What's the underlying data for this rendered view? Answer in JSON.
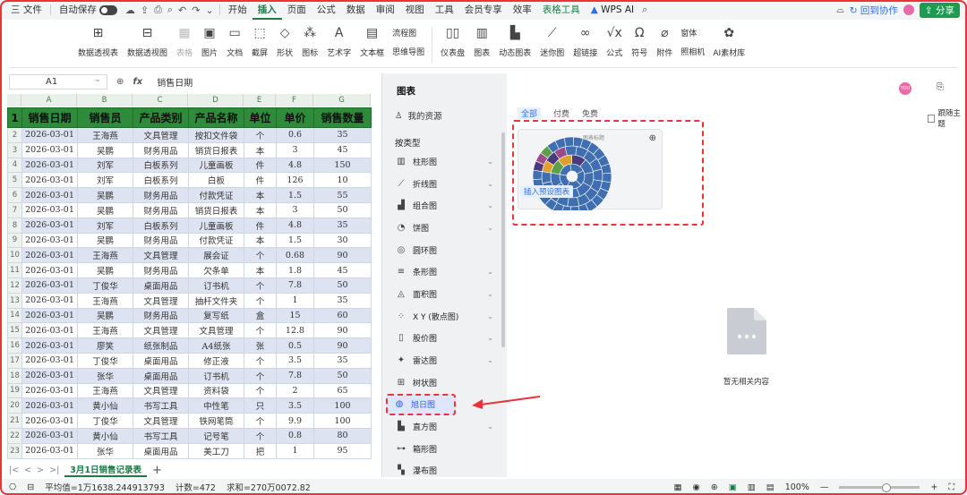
{
  "menubar": {
    "file": "三 文件",
    "autosave": "自动保存",
    "tabs": [
      "开始",
      "插入",
      "页面",
      "公式",
      "数据",
      "审阅",
      "视图",
      "工具",
      "会员专享",
      "效率"
    ],
    "active_tab": "插入",
    "table_tools": "表格工具",
    "wps_ai": "WPS AI",
    "collab": "回到协作",
    "share": "分享"
  },
  "ribbon": {
    "items": [
      {
        "icon": "pivot-table-icon",
        "label": "数据透视表"
      },
      {
        "icon": "pivot-chart-icon",
        "label": "数据透视图"
      },
      {
        "icon": "table-icon",
        "label": "表格",
        "dim": true
      },
      {
        "icon": "picture-icon",
        "label": "图片"
      },
      {
        "icon": "document-icon",
        "label": "文档"
      },
      {
        "icon": "screenshot-icon",
        "label": "截屏"
      },
      {
        "icon": "shape-icon",
        "label": "形状"
      },
      {
        "icon": "chart-icon",
        "label": "图标"
      },
      {
        "icon": "wordart-icon",
        "label": "艺术字"
      },
      {
        "icon": "textbox-icon",
        "label": "文本框"
      }
    ],
    "stack1": [
      "流程图",
      "思维导图"
    ],
    "items2": [
      {
        "icon": "dashboard-icon",
        "label": "仪表盘"
      },
      {
        "icon": "bar-chart-icon",
        "label": "图表"
      },
      {
        "icon": "dynamic-chart-icon",
        "label": "动态图表"
      },
      {
        "icon": "sparkline-icon",
        "label": "迷你图"
      },
      {
        "icon": "link-icon",
        "label": "超链接"
      },
      {
        "icon": "formula-icon",
        "label": "公式"
      },
      {
        "icon": "symbol-icon",
        "label": "符号"
      },
      {
        "icon": "attachment-icon",
        "label": "附件"
      }
    ],
    "stack2": [
      "窗体",
      "照相机"
    ],
    "ai_assets": "AI素材库"
  },
  "formula_bar": {
    "cell_ref": "A1",
    "content": "销售日期"
  },
  "sheet": {
    "columns": [
      "A",
      "B",
      "C",
      "D",
      "E",
      "F",
      "G"
    ],
    "headers": [
      "销售日期",
      "销售员",
      "产品类别",
      "产品名称",
      "单位",
      "单价",
      "销售数量"
    ],
    "rows": [
      [
        "2026-03-01",
        "王海燕",
        "文具管理",
        "按扣文件袋",
        "个",
        "0.6",
        "35"
      ],
      [
        "2026-03-01",
        "吴鹏",
        "财务用品",
        "销货日报表",
        "本",
        "3",
        "45"
      ],
      [
        "2026-03-01",
        "刘军",
        "白板系列",
        "儿童画板",
        "件",
        "4.8",
        "150"
      ],
      [
        "2026-03-01",
        "刘军",
        "白板系列",
        "白板",
        "件",
        "126",
        "10"
      ],
      [
        "2026-03-01",
        "吴鹏",
        "财务用品",
        "付款凭证",
        "本",
        "1.5",
        "55"
      ],
      [
        "2026-03-01",
        "吴鹏",
        "财务用品",
        "销货日报表",
        "本",
        "3",
        "50"
      ],
      [
        "2026-03-01",
        "刘军",
        "白板系列",
        "儿童画板",
        "件",
        "4.8",
        "35"
      ],
      [
        "2026-03-01",
        "吴鹏",
        "财务用品",
        "付款凭证",
        "本",
        "1.5",
        "30"
      ],
      [
        "2026-03-01",
        "王海燕",
        "文具管理",
        "展会证",
        "个",
        "0.68",
        "90"
      ],
      [
        "2026-03-01",
        "吴鹏",
        "财务用品",
        "欠条单",
        "本",
        "1.8",
        "45"
      ],
      [
        "2026-03-01",
        "丁俊华",
        "桌面用品",
        "订书机",
        "个",
        "7.8",
        "50"
      ],
      [
        "2026-03-01",
        "王海燕",
        "文具管理",
        "抽杆文件夹",
        "个",
        "1",
        "35"
      ],
      [
        "2026-03-01",
        "吴鹏",
        "财务用品",
        "复写纸",
        "盒",
        "15",
        "60"
      ],
      [
        "2026-03-01",
        "王海燕",
        "文具管理",
        "文具管理",
        "个",
        "12.8",
        "90"
      ],
      [
        "2026-03-01",
        "廖笑",
        "纸张制品",
        "A4纸张",
        "张",
        "0.5",
        "90"
      ],
      [
        "2026-03-01",
        "丁俊华",
        "桌面用品",
        "修正液",
        "个",
        "3.5",
        "35"
      ],
      [
        "2026-03-01",
        "张华",
        "桌面用品",
        "订书机",
        "个",
        "7.8",
        "50"
      ],
      [
        "2026-03-01",
        "王海燕",
        "文具管理",
        "资料袋",
        "个",
        "2",
        "65"
      ],
      [
        "2026-03-01",
        "黄小仙",
        "书写工具",
        "中性笔",
        "只",
        "3.5",
        "100"
      ],
      [
        "2026-03-01",
        "丁俊华",
        "文具管理",
        "铁网笔筒",
        "个",
        "9.9",
        "100"
      ],
      [
        "2026-03-01",
        "黄小仙",
        "书写工具",
        "记号笔",
        "个",
        "0.8",
        "80"
      ],
      [
        "2026-03-01",
        "张华",
        "桌面用品",
        "美工刀",
        "把",
        "1",
        "95"
      ]
    ],
    "tab_name": "3月1日销售记录表"
  },
  "status": {
    "average": "平均值=1万1638.244913793",
    "count": "计数=472",
    "sum": "求和=270万0072.82",
    "zoom": "100%"
  },
  "chart_panel": {
    "title": "图表",
    "my_resources": "我的资源",
    "by_type": "按类型",
    "types": [
      {
        "icon": "bar-icon",
        "label": "柱形图",
        "chev": true
      },
      {
        "icon": "line-icon",
        "label": "折线图",
        "chev": true
      },
      {
        "icon": "combo-icon",
        "label": "组合图",
        "chev": true
      },
      {
        "icon": "pie-icon",
        "label": "饼图",
        "chev": true
      },
      {
        "icon": "donut-icon",
        "label": "圆环图",
        "chev": false
      },
      {
        "icon": "hbar-icon",
        "label": "条形图",
        "chev": true
      },
      {
        "icon": "area-icon",
        "label": "面积图",
        "chev": true
      },
      {
        "icon": "scatter-icon",
        "label": "X Y (散点图)",
        "chev": true
      },
      {
        "icon": "stock-icon",
        "label": "股价图",
        "chev": true
      },
      {
        "icon": "radar-icon",
        "label": "雷达图",
        "chev": true
      },
      {
        "icon": "treemap-icon",
        "label": "树状图",
        "chev": false
      },
      {
        "icon": "sunburst-icon",
        "label": "旭日图",
        "chev": false,
        "selected": true
      },
      {
        "icon": "histogram-icon",
        "label": "直方图",
        "chev": true
      },
      {
        "icon": "box-icon",
        "label": "箱形图",
        "chev": false
      },
      {
        "icon": "waterfall-icon",
        "label": "瀑布图",
        "chev": false
      }
    ],
    "filters": [
      "全部",
      "付费",
      "免费"
    ],
    "active_filter": "全部",
    "card_title": "图表标题",
    "insert_preset": "插入预设图表",
    "empty_text": "暂无相关内容",
    "follow_theme": "跟随主题"
  }
}
